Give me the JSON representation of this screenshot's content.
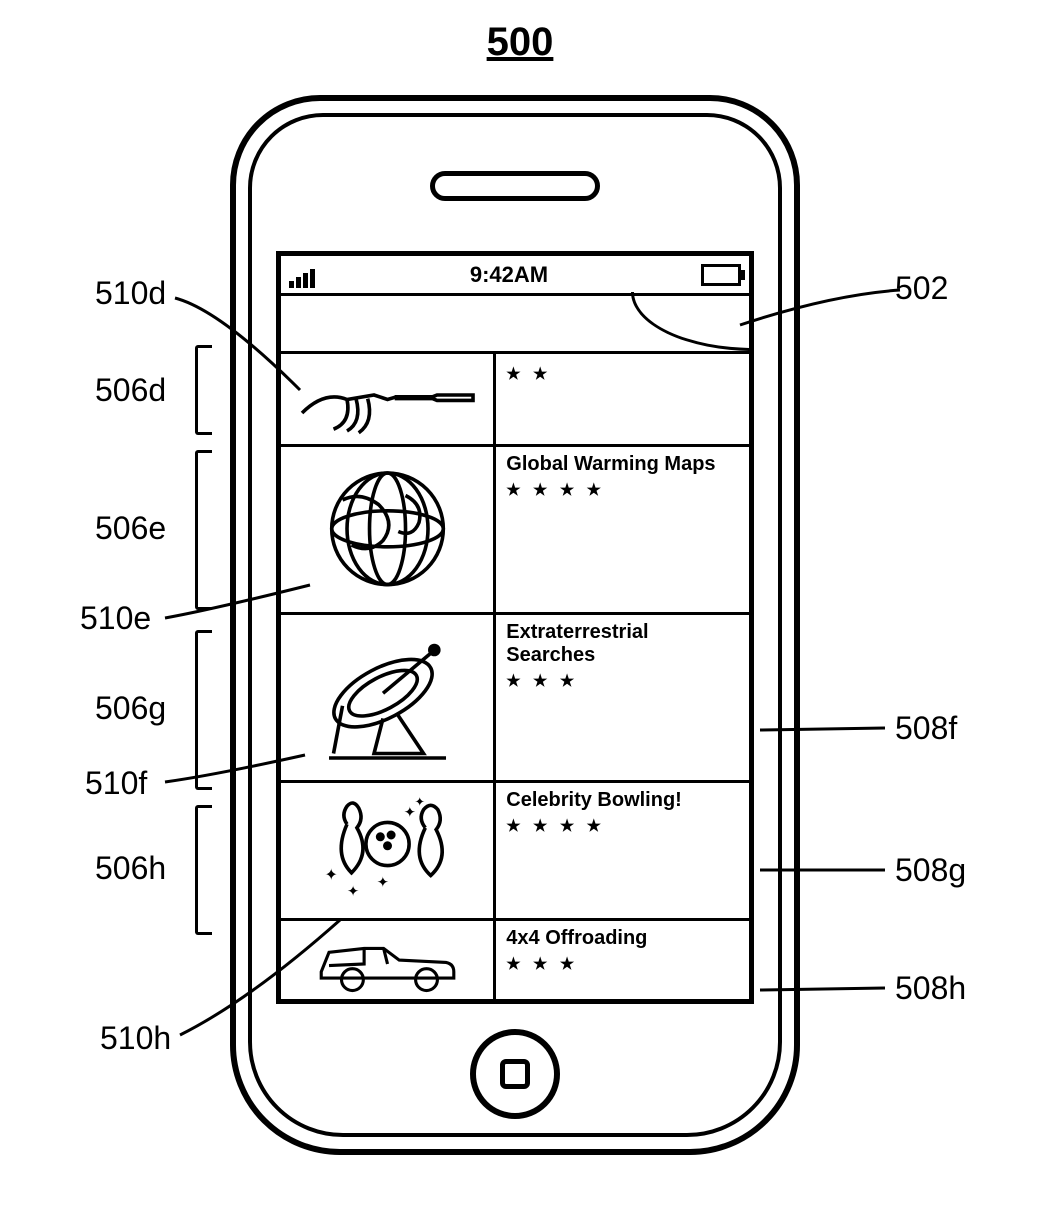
{
  "figure": {
    "number": "500"
  },
  "status_bar": {
    "time": "9:42AM"
  },
  "rows": [
    {
      "id": "d",
      "title": "",
      "stars": "★ ★",
      "icon": "screwdriver-icon"
    },
    {
      "id": "e",
      "title": "Global Warming Maps",
      "stars": "★ ★ ★ ★",
      "icon": "globe-icon"
    },
    {
      "id": "g",
      "title": "Extraterrestrial Searches",
      "stars": "★ ★ ★",
      "icon": "satellite-dish-icon"
    },
    {
      "id": "h",
      "title": "Celebrity Bowling!",
      "stars": "★ ★ ★ ★",
      "icon": "bowling-icon"
    },
    {
      "id": "i",
      "title": "4x4 Offroading",
      "stars": "★ ★ ★",
      "icon": "truck-icon"
    }
  ],
  "callouts": {
    "top_right": "502",
    "left": {
      "506d": "506d",
      "506e": "506e",
      "506g": "506g",
      "506h": "506h",
      "510d": "510d",
      "510e": "510e",
      "510f": "510f",
      "510h": "510h"
    },
    "right": {
      "508f": "508f",
      "508g": "508g",
      "508h": "508h"
    }
  }
}
